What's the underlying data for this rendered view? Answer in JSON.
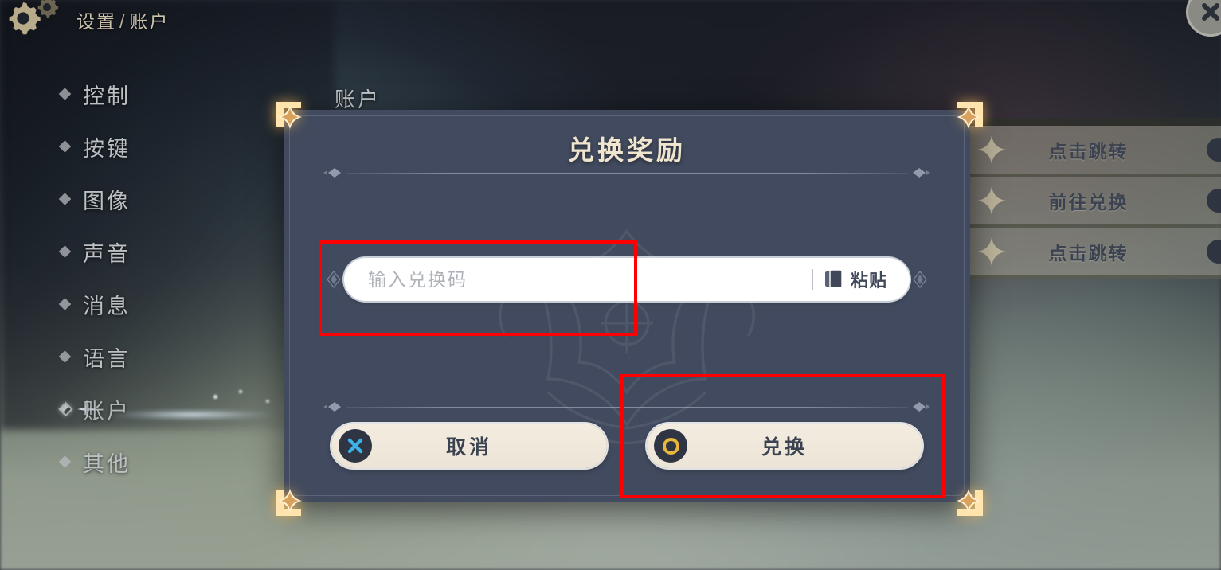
{
  "app": {
    "breadcrumb": {
      "root": "设置",
      "separator": "/",
      "current": "账户"
    },
    "gear_icon": "gear-icon",
    "close_icon": "close-x-icon"
  },
  "sidebar": {
    "items": [
      {
        "label": "控制",
        "icon": "diamond-bullet-icon",
        "selected": false
      },
      {
        "label": "按键",
        "icon": "diamond-bullet-icon",
        "selected": false
      },
      {
        "label": "图像",
        "icon": "diamond-bullet-icon",
        "selected": false
      },
      {
        "label": "声音",
        "icon": "diamond-bullet-icon",
        "selected": false
      },
      {
        "label": "消息",
        "icon": "diamond-bullet-icon",
        "selected": false
      },
      {
        "label": "语言",
        "icon": "diamond-bullet-icon",
        "selected": false
      },
      {
        "label": "账户",
        "icon": "diamond-bullet-icon",
        "selected": true
      },
      {
        "label": "其他",
        "icon": "diamond-bullet-icon",
        "selected": false
      }
    ]
  },
  "content": {
    "header": "账户"
  },
  "right_panel": {
    "rows": [
      {
        "label": "点击跳转",
        "icon": "sparkle-icon"
      },
      {
        "label": "前往兑换",
        "icon": "sparkle-icon"
      },
      {
        "label": "点击跳转",
        "icon": "sparkle-icon"
      }
    ]
  },
  "dialog": {
    "title": "兑换奖励",
    "corner_icon": "corner-ornament-icon",
    "divider_icon": "diamond-sparkle-icon",
    "input": {
      "value": "",
      "placeholder": "输入兑换码",
      "paste_label": "粘贴",
      "paste_icon": "clipboard-copy-icon"
    },
    "buttons": [
      {
        "label": "取消",
        "icon": "close-x-circle-icon",
        "icon_color": "#3bb3e8"
      },
      {
        "label": "兑换",
        "icon": "gold-ring-icon",
        "icon_color": "#e8b73b"
      }
    ]
  },
  "annotations": {
    "boxes": [
      {
        "target": "code-input-field",
        "color": "#ff0000"
      },
      {
        "target": "redeem-button",
        "color": "#ff0000"
      }
    ]
  },
  "colors": {
    "dialog_bg": "#414a5e",
    "title_gold": "#f0e6cf",
    "button_cream": "#ece4d6",
    "annotation_red": "#ff0000",
    "accent_blue": "#3bb3e8",
    "accent_gold": "#e8b73b"
  }
}
